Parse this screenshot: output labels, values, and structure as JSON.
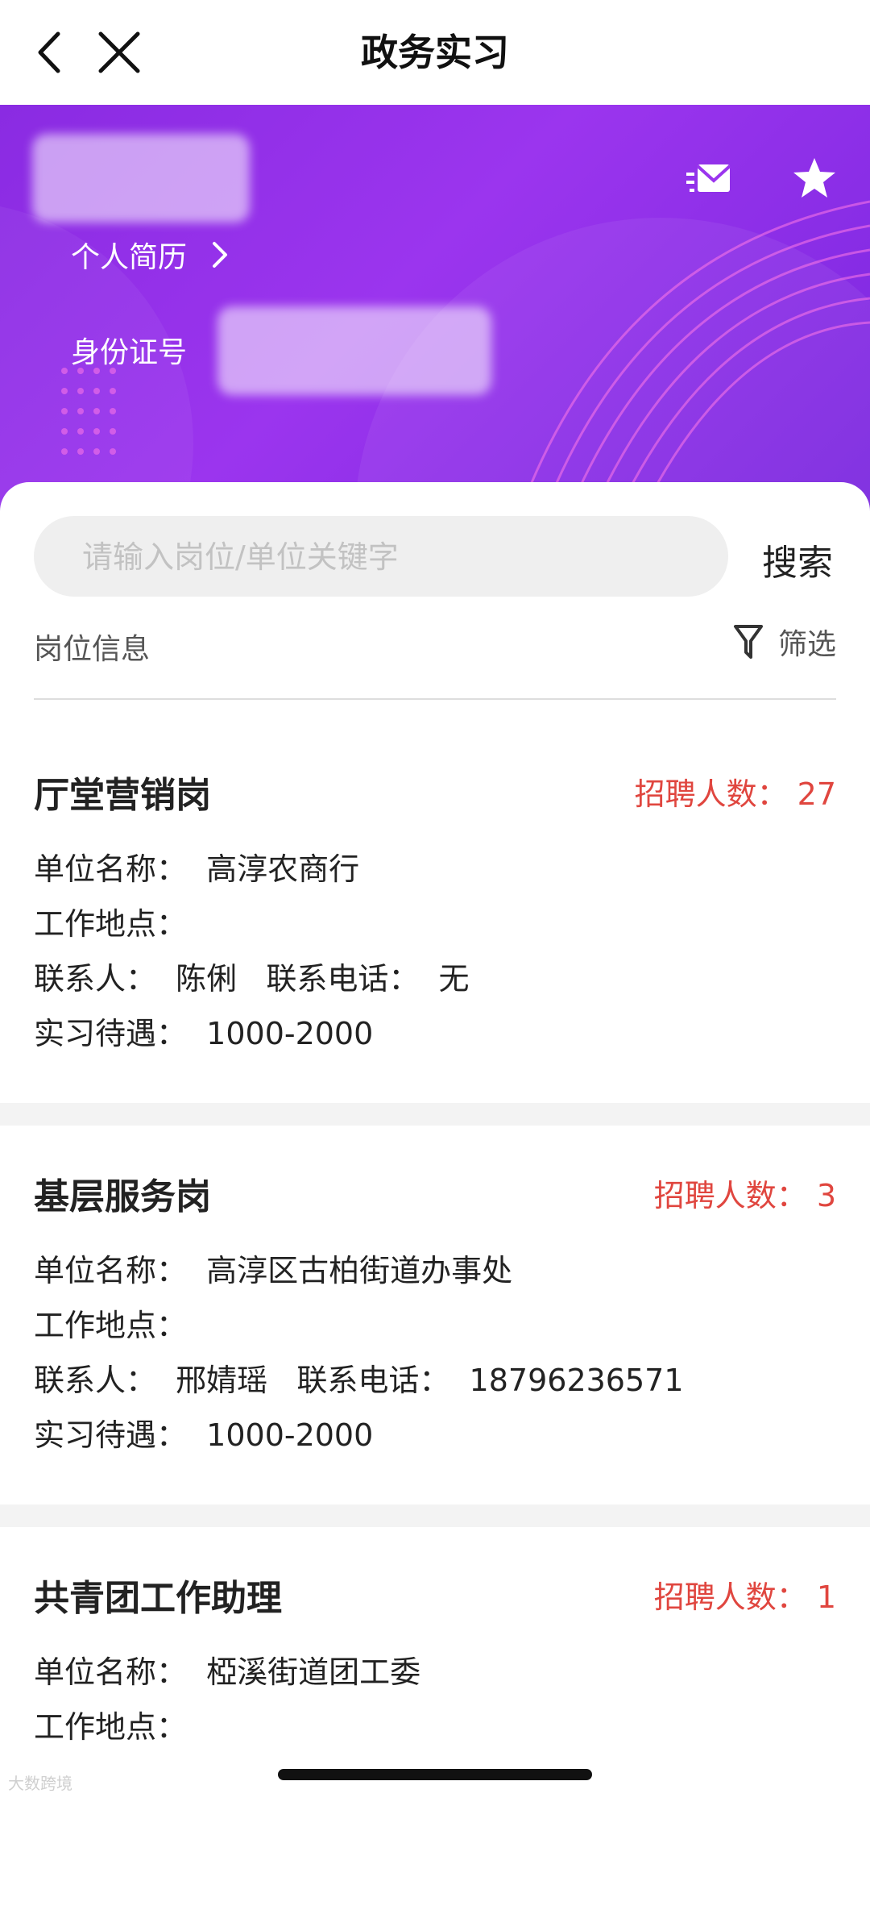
{
  "navbar": {
    "title": "政务实习"
  },
  "hero": {
    "resume_label": "个人简历",
    "id_label": "身份证号"
  },
  "search": {
    "placeholder": "请输入岗位/单位关键字",
    "button": "搜索"
  },
  "section": {
    "title": "岗位信息",
    "filter_label": "筛选"
  },
  "jobs": [
    {
      "title": "厅堂营销岗",
      "count": "招聘人数：  27",
      "unit": "单位名称：  高淳农商行",
      "location": "工作地点：",
      "contact": "联系人：  陈俐   联系电话：  无",
      "pay": "实习待遇：  1000-2000"
    },
    {
      "title": "基层服务岗",
      "count": "招聘人数：  3",
      "unit": "单位名称：  高淳区古柏街道办事处",
      "location": "工作地点：",
      "contact": "联系人：  邢婧瑶   联系电话：  18796236571",
      "pay": "实习待遇：  1000-2000"
    },
    {
      "title": "共青团工作助理",
      "count": "招聘人数：  1",
      "unit": "单位名称：  椏溪街道团工委",
      "location": "工作地点：",
      "contact": "",
      "pay": ""
    }
  ],
  "watermark": "大数跨境",
  "colors": {
    "hero_purple": "#8a2be2",
    "count_red": "#e0463f"
  }
}
